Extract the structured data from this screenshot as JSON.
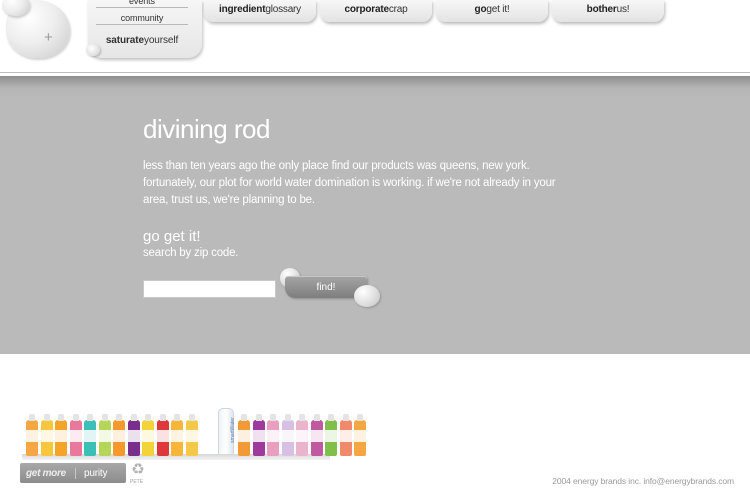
{
  "nav": {
    "submenu": {
      "events": "events",
      "community": "community",
      "saturate_bold": "saturate",
      "saturate_rest": "yourself"
    },
    "tabs": [
      {
        "bold": "ingredient",
        "rest": "glossary"
      },
      {
        "bold": "corporate",
        "rest": "crap"
      },
      {
        "bold": "go",
        "rest": "get it!"
      },
      {
        "bold": "bother",
        "rest": "us!"
      }
    ]
  },
  "main": {
    "title": "divining rod",
    "intro": "less than ten years ago the only place find our products was queens, new york. fortunately, our plot for world water domination is working. if we're not already in your area, trust us, we're planning to be.",
    "section_title": "go get it!",
    "section_sub": "search by zip code.",
    "zip_value": "",
    "find_label": "find!"
  },
  "footer": {
    "tall_bottle_label": "smartWater",
    "badge_left": "get more",
    "badge_right": "purity",
    "recycle_label": "PETE",
    "copyright": "2004 energy brands inc.  info@energybrands.com"
  },
  "colors": {
    "band": "#bababa",
    "text_on_band": "#ffffff",
    "bottles": [
      "#f4a742",
      "#f7c63c",
      "#f5a428",
      "#e9799c",
      "#3bbfb7",
      "#b6d65a",
      "#f59a2a",
      "#7a2e8c",
      "#f2d43a",
      "#e0383a",
      "#f5b63a",
      "#f6c84a",
      "#f29a36",
      "#9e3a9c",
      "#e9a0c0",
      "#d8c0e4",
      "#ebb3cc",
      "#c05aa0",
      "#7fbf4a",
      "#f08a6a",
      "#f4a742"
    ]
  },
  "icons": {
    "plus": "plus-icon",
    "recycle": "recycle-icon"
  }
}
